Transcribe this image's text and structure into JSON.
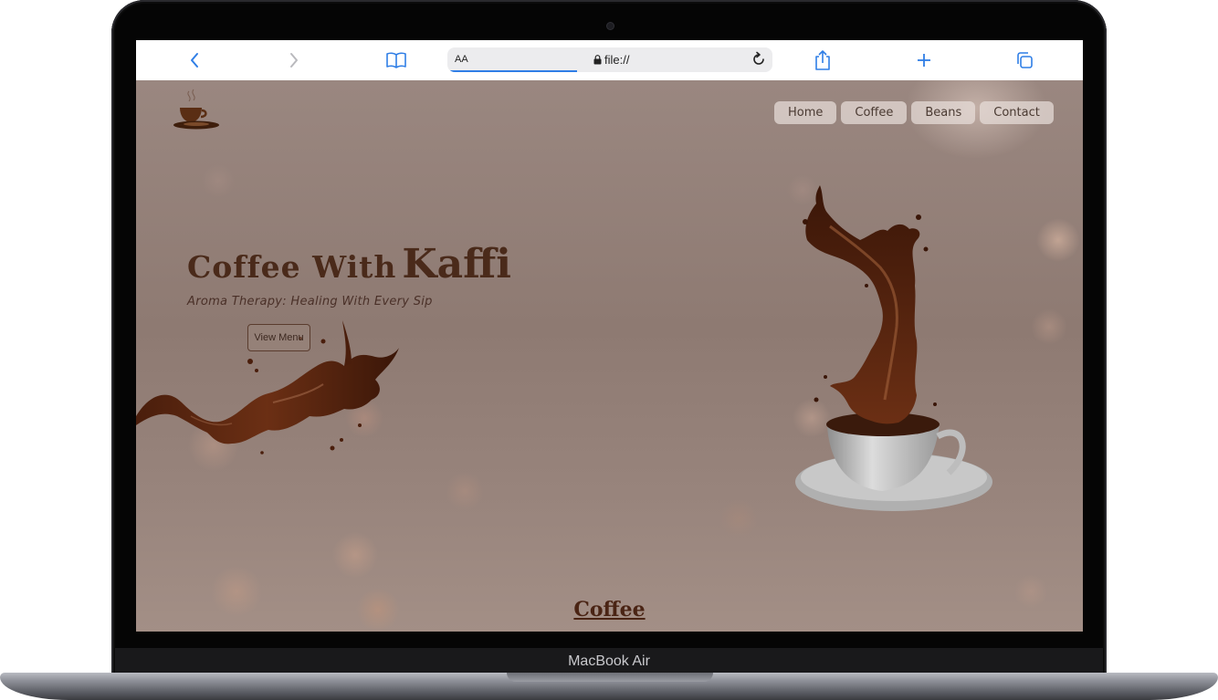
{
  "device": {
    "label": "MacBook Air"
  },
  "browser": {
    "text_size_label": "AA",
    "url": "file://",
    "icons": {
      "back": "chevron-left-icon",
      "forward": "chevron-right-icon",
      "bookmarks": "book-icon",
      "reload": "reload-icon",
      "share": "share-icon",
      "new_tab": "plus-icon",
      "tabs": "tabs-icon"
    },
    "accent_color": "#2f7ee6"
  },
  "site": {
    "nav": [
      {
        "label": "Home"
      },
      {
        "label": "Coffee"
      },
      {
        "label": "Beans"
      },
      {
        "label": "Contact"
      }
    ],
    "hero": {
      "title_part1": "Coffee With",
      "title_part2": "Kaffi",
      "subtitle": "Aroma Therapy: Healing With Every Sip",
      "cta_label": "View Menu"
    },
    "section_heading": "Coffee",
    "colors": {
      "title": "#4a2a1a",
      "nav_bg": "#e8deda"
    }
  }
}
